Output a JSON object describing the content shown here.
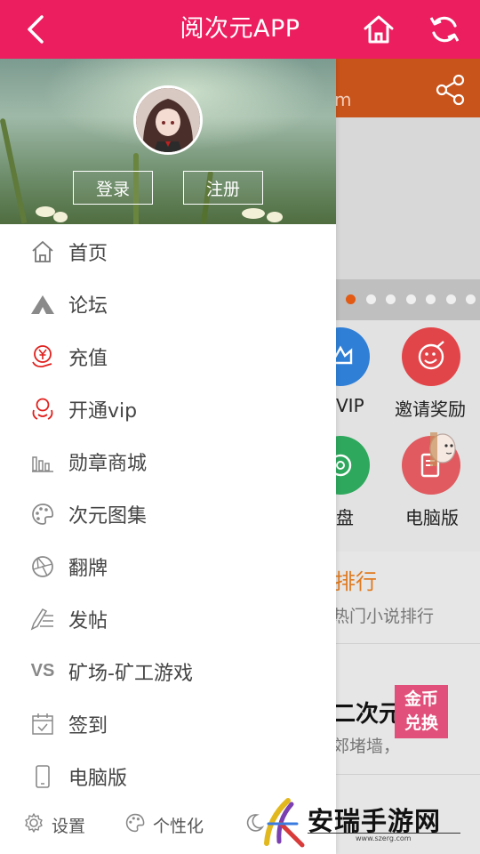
{
  "app": {
    "title": "阅次元APP",
    "accent": "#ec1e5f"
  },
  "topbar": {
    "back_icon": "chevron-left-icon",
    "home_icon": "home-icon",
    "refresh_icon": "refresh-icon"
  },
  "background": {
    "url_fragment": "m",
    "grid": [
      {
        "label": "VIP",
        "color": "#2f7fd6",
        "icon": "crown-icon"
      },
      {
        "label": "邀请奖励",
        "color": "#e24549",
        "icon": "smile-edit-icon"
      },
      {
        "label": "盘",
        "color": "#2ea85d",
        "icon": "aperture-icon"
      },
      {
        "label": "电脑版",
        "color": "#e05a5f",
        "icon": "monitor-icon"
      }
    ],
    "rank_title": "排行",
    "rank_sub": "热门小说排行",
    "novel_title": "二次元小说",
    "novel_sub": "郊堵墙，",
    "coin_badge": "金币兑换",
    "carousel": {
      "count": 7,
      "active_index": 0
    }
  },
  "drawer": {
    "login_label": "登录",
    "register_label": "注册",
    "menu": [
      {
        "label": "首页",
        "icon": "home-icon"
      },
      {
        "label": "论坛",
        "icon": "tent-icon"
      },
      {
        "label": "充值",
        "icon": "yen-coin-icon"
      },
      {
        "label": "开通vip",
        "icon": "vip-hands-icon"
      },
      {
        "label": "勋章商城",
        "icon": "bar-chart-icon"
      },
      {
        "label": "次元图集",
        "icon": "palette-icon"
      },
      {
        "label": "翻牌",
        "icon": "aperture-icon"
      },
      {
        "label": "发帖",
        "icon": "pen-list-icon"
      },
      {
        "label": "矿场-矿工游戏",
        "icon": "vs-icon"
      },
      {
        "label": "签到",
        "icon": "calendar-check-icon"
      },
      {
        "label": "电脑版",
        "icon": "phone-icon"
      }
    ],
    "footer": [
      {
        "label": "设置",
        "icon": "gear-icon"
      },
      {
        "label": "个性化",
        "icon": "palette-icon"
      },
      {
        "label": "",
        "icon": "moon-icon"
      }
    ]
  },
  "watermark": {
    "text": "安瑞手游网",
    "url": "www.szerg.com"
  }
}
